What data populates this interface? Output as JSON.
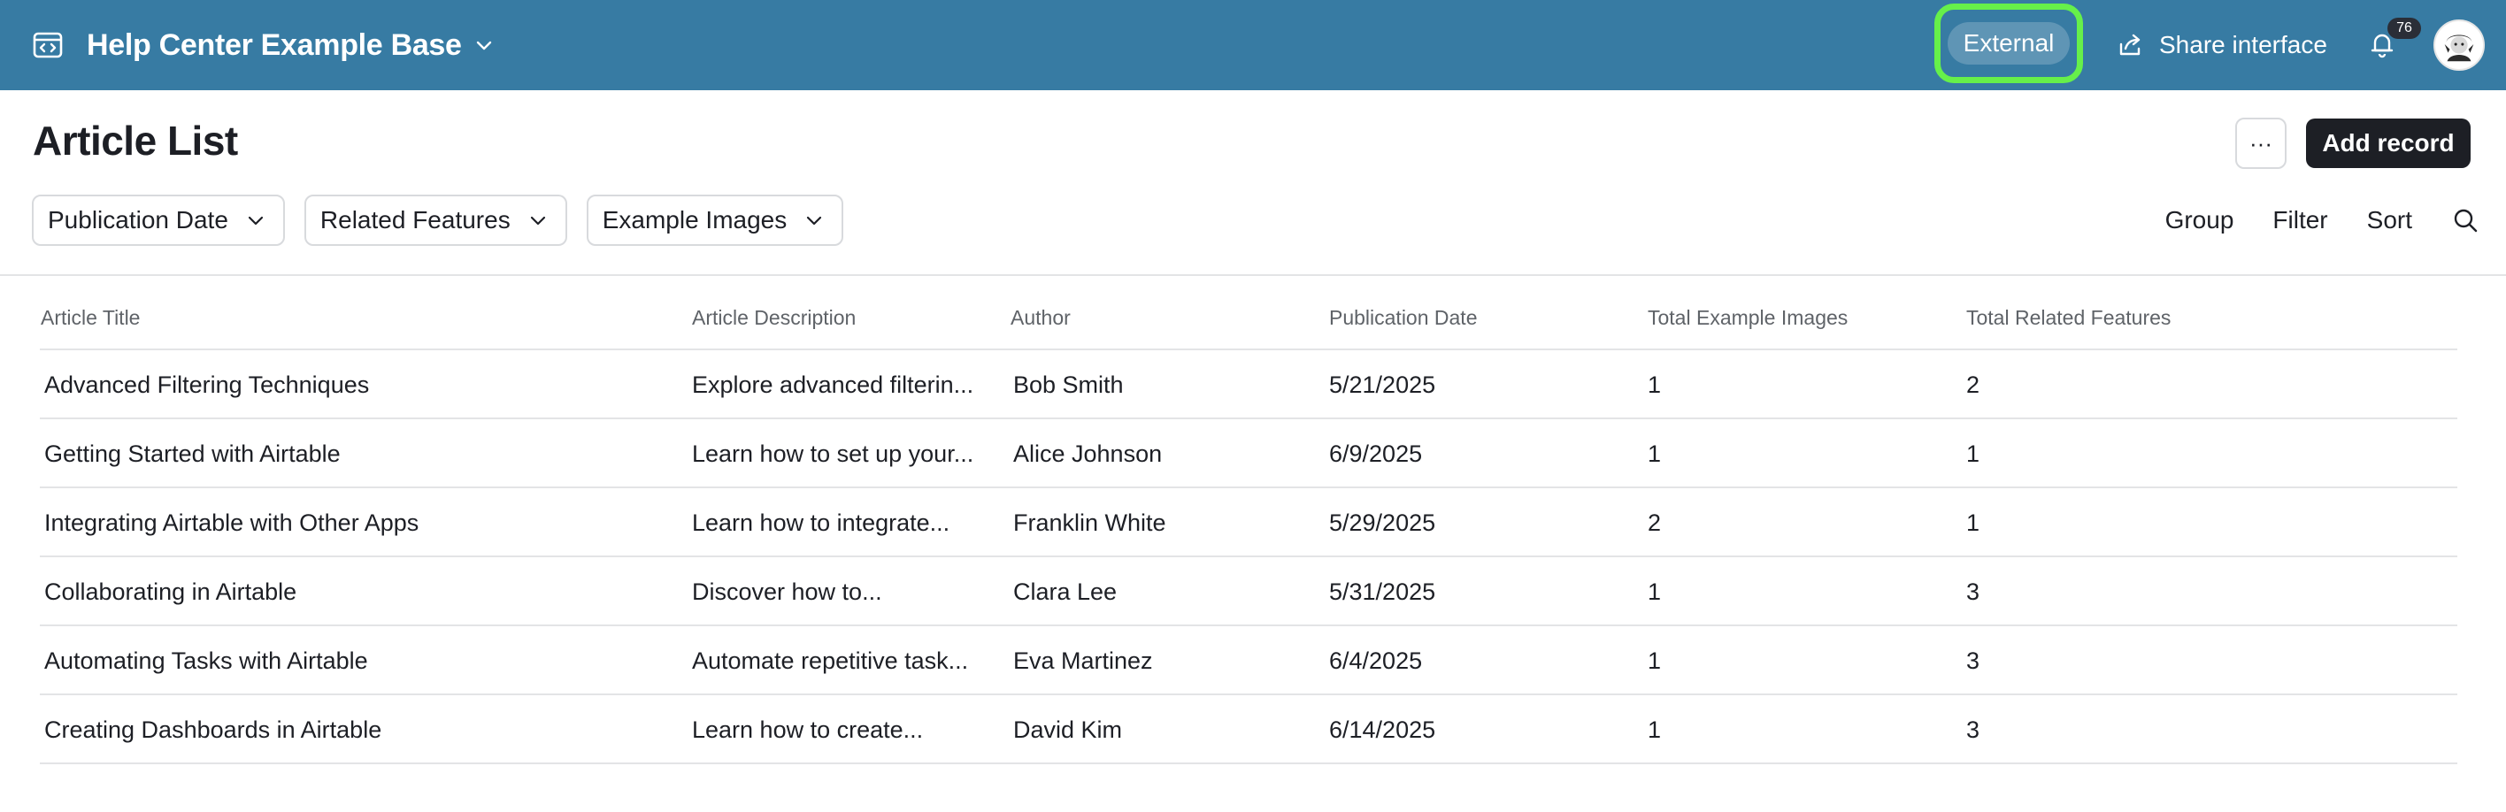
{
  "topbar": {
    "base_name": "Help Center Example Base",
    "external_label": "External",
    "share_label": "Share interface",
    "notification_count": "76",
    "colors": {
      "background": "#377ba3",
      "highlight": "#66f04a"
    }
  },
  "page": {
    "title": "Article List",
    "more_label": "···",
    "add_record_label": "Add record"
  },
  "filters": [
    {
      "label": "Publication Date"
    },
    {
      "label": "Related Features"
    },
    {
      "label": "Example Images"
    }
  ],
  "view_tools": {
    "group_label": "Group",
    "filter_label": "Filter",
    "sort_label": "Sort"
  },
  "table": {
    "columns": [
      "Article Title",
      "Article Description",
      "Author",
      "Publication Date",
      "Total Example Images",
      "Total Related Features"
    ],
    "rows": [
      [
        "Advanced Filtering Techniques",
        "Explore advanced filterin...",
        "Bob Smith",
        "5/21/2025",
        "1",
        "2"
      ],
      [
        "Getting Started with Airtable",
        "Learn how to set up your...",
        "Alice Johnson",
        "6/9/2025",
        "1",
        "1"
      ],
      [
        "Integrating Airtable with Other Apps",
        "Learn how to integrate...",
        "Franklin White",
        "5/29/2025",
        "2",
        "1"
      ],
      [
        "Collaborating in Airtable",
        "Discover how to...",
        "Clara Lee",
        "5/31/2025",
        "1",
        "3"
      ],
      [
        "Automating Tasks with Airtable",
        "Automate repetitive task...",
        "Eva Martinez",
        "6/4/2025",
        "1",
        "3"
      ],
      [
        "Creating Dashboards in Airtable",
        "Learn how to create...",
        "David Kim",
        "6/14/2025",
        "1",
        "3"
      ]
    ]
  },
  "icons": {
    "app": "interface-app-icon",
    "base_menu": "chevron-down-icon",
    "share": "share-icon",
    "notifications": "bell-icon",
    "user": "avatar-icon",
    "search": "search-icon"
  }
}
